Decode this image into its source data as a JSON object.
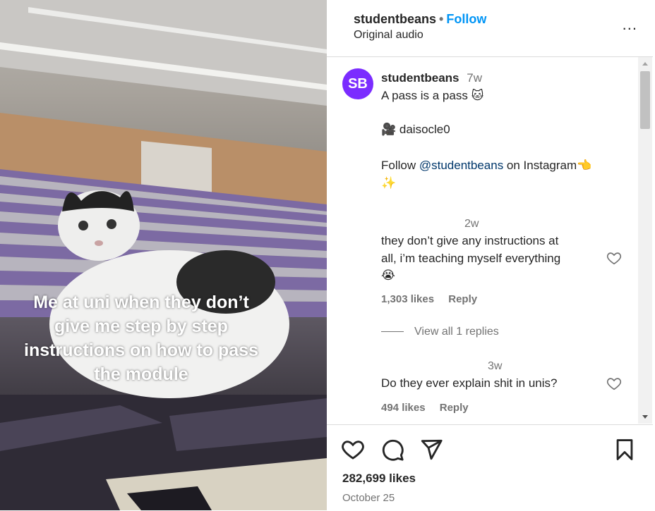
{
  "post": {
    "caption_overlay": "Me at uni when they don’t give me step by step instructions on how to pass the module"
  },
  "header": {
    "username": "studentbeans",
    "separator": "•",
    "follow_label": "Follow",
    "audio_label": "Original audio",
    "more_label": "..."
  },
  "caption_comment": {
    "avatar_text": "SB",
    "username": "studentbeans",
    "time": "7w",
    "line1": "A pass is a pass 🐱",
    "credit": "🎥 daisocle0",
    "follow_prefix": "Follow ",
    "mention": "@studentbeans",
    "follow_suffix": " on Instagram👈",
    "sparkle": "✨"
  },
  "comments": [
    {
      "time": "2w",
      "text_line1": "they don’t give any instructions at",
      "text_line2": "all, i’m teaching myself everything",
      "emoji": "😭",
      "likes": "1,303 likes",
      "reply_label": "Reply",
      "view_replies": "View all 1 replies"
    },
    {
      "time": "3w",
      "text_line1": "Do they ever explain shit in unis?",
      "likes": "494 likes",
      "reply_label": "Reply"
    }
  ],
  "footer": {
    "likes": "282,699 likes",
    "date": "October 25"
  },
  "colors": {
    "accent": "#0095f6",
    "avatar_bg": "#7b2cff",
    "mention": "#00376b",
    "muted": "#737373"
  }
}
